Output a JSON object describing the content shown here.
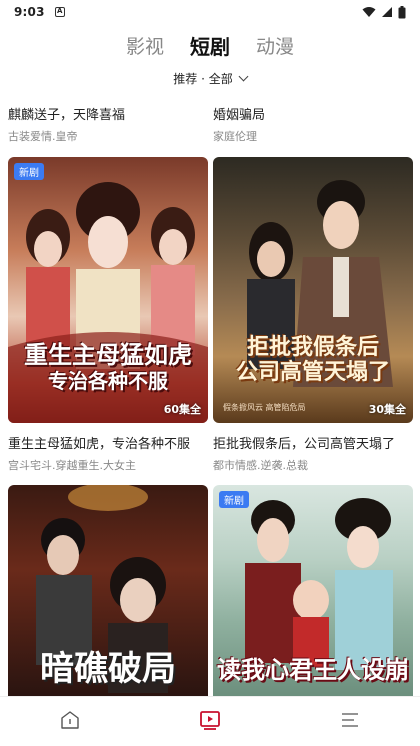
{
  "status": {
    "time": "9:03",
    "notif_letter": "A"
  },
  "tabs": [
    {
      "label": "影视",
      "active": false
    },
    {
      "label": "短剧",
      "active": true
    },
    {
      "label": "动漫",
      "active": false
    }
  ],
  "filter": {
    "label": "推荐 · 全部"
  },
  "items": [
    {
      "title": "麒麟送子，天降喜福",
      "tags": "古装爱情.皇帝"
    },
    {
      "title": "婚姻骗局",
      "tags": "家庭伦理"
    },
    {
      "title": "重生主母猛如虎，专治各种不服",
      "tags": "宫斗宅斗.穿越重生.大女主",
      "badge": "新剧",
      "episodes": "60集全",
      "poster_line1": "重生主母猛如虎",
      "poster_line2": "专治各种不服"
    },
    {
      "title": "拒批我假条后，公司高管天塌了",
      "tags": "都市情感.逆袭.总裁",
      "episodes": "30集全",
      "poster_line1": "拒批我假条后",
      "poster_line2": "公司高管天塌了",
      "poster_small": "假条掀风云   高管陷危局"
    },
    {
      "poster_line1": "暗礁破局"
    },
    {
      "badge": "新剧",
      "poster_line1": "读我心君王人设崩"
    }
  ],
  "nav": [
    {
      "icon": "home-icon"
    },
    {
      "icon": "play-video-icon"
    },
    {
      "icon": "menu-icon"
    }
  ],
  "colors": {
    "accent": "#e8344a",
    "badge": "#3b7bf2"
  }
}
